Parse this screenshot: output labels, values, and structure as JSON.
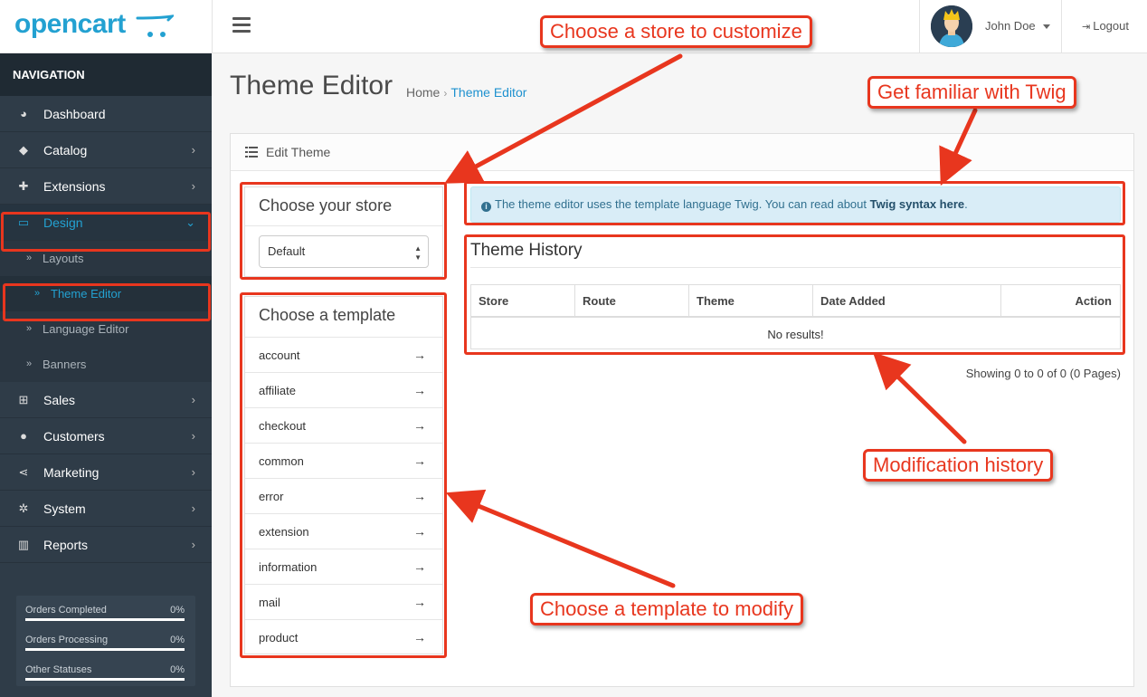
{
  "header": {
    "logo_text": "opencart",
    "user_name": "John Doe",
    "logout_label": "Logout"
  },
  "sidebar": {
    "heading": "NAVIGATION",
    "items": [
      {
        "label": "Dashboard",
        "icon": "dashboard-icon"
      },
      {
        "label": "Catalog",
        "icon": "tags-icon"
      },
      {
        "label": "Extensions",
        "icon": "puzzle-icon"
      },
      {
        "label": "Design",
        "icon": "monitor-icon"
      },
      {
        "label": "Sales",
        "icon": "cart-icon"
      },
      {
        "label": "Customers",
        "icon": "user-icon"
      },
      {
        "label": "Marketing",
        "icon": "share-icon"
      },
      {
        "label": "System",
        "icon": "gear-icon"
      },
      {
        "label": "Reports",
        "icon": "bar-chart-icon"
      }
    ],
    "design_sub": [
      "Layouts",
      "Theme Editor",
      "Language Editor",
      "Banners"
    ],
    "stats": [
      {
        "label": "Orders Completed",
        "value": "0%"
      },
      {
        "label": "Orders Processing",
        "value": "0%"
      },
      {
        "label": "Other Statuses",
        "value": "0%"
      }
    ]
  },
  "page": {
    "title": "Theme Editor",
    "breadcrumb_home": "Home",
    "breadcrumb_current": "Theme Editor",
    "panel_title": "Edit Theme"
  },
  "store": {
    "title": "Choose your store",
    "selected": "Default"
  },
  "templates": {
    "title": "Choose a template",
    "items": [
      "account",
      "affiliate",
      "checkout",
      "common",
      "error",
      "extension",
      "information",
      "mail",
      "product"
    ]
  },
  "alert": {
    "text": "The theme editor uses the template language Twig. You can read about",
    "link": "Twig syntax here",
    "end": "."
  },
  "history": {
    "title": "Theme History",
    "columns": [
      "Store",
      "Route",
      "Theme",
      "Date Added",
      "Action"
    ],
    "empty": "No results!",
    "pagination": "Showing 0 to 0 of 0 (0 Pages)"
  },
  "annotations": {
    "store": "Choose a store to customize",
    "twig": "Get familiar with Twig",
    "history": "Modification history",
    "template": "Choose a template to modify"
  },
  "colors": {
    "accent": "#23a1d1",
    "annotation": "#e8361e",
    "sidebar_bg": "#2f3c48"
  }
}
